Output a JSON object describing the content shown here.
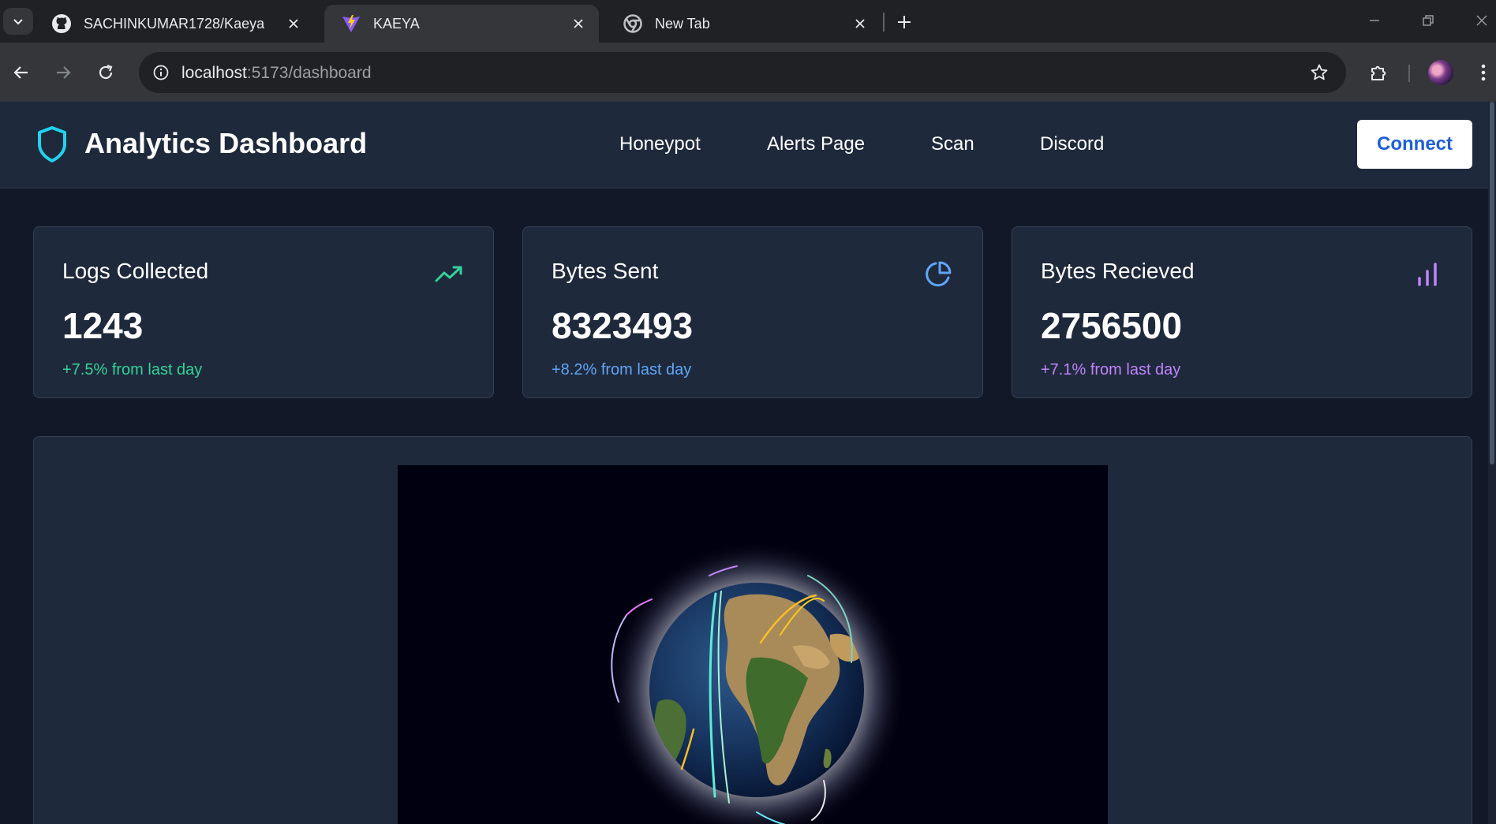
{
  "browser": {
    "tabs": [
      {
        "title": "SACHINKUMAR1728/Kaeya",
        "icon": "github-icon",
        "active": false
      },
      {
        "title": "KAEYA",
        "icon": "vite-icon",
        "active": true
      },
      {
        "title": "New Tab",
        "icon": "chrome-icon",
        "active": false
      }
    ],
    "url_host": "localhost",
    "url_path": ":5173/dashboard"
  },
  "app": {
    "title": "Analytics Dashboard",
    "nav": [
      "Honeypot",
      "Alerts Page",
      "Scan",
      "Discord"
    ],
    "connect_label": "Connect"
  },
  "stats": [
    {
      "title": "Logs Collected",
      "value": "1243",
      "change": "+7.5% from last day",
      "icon": "trending-up-icon",
      "color": "#34d399"
    },
    {
      "title": "Bytes Sent",
      "value": "8323493",
      "change": "+8.2% from last day",
      "icon": "pie-chart-icon",
      "color": "#60a5fa"
    },
    {
      "title": "Bytes Recieved",
      "value": "2756500",
      "change": "+7.1% from last day",
      "icon": "bar-chart-icon",
      "color": "#c084fc"
    }
  ],
  "colors": {
    "nav_bg": "#1e293b",
    "page_bg": "#111827",
    "brand_icon": "#22d3ee",
    "connect_text": "#1d5fd6"
  }
}
